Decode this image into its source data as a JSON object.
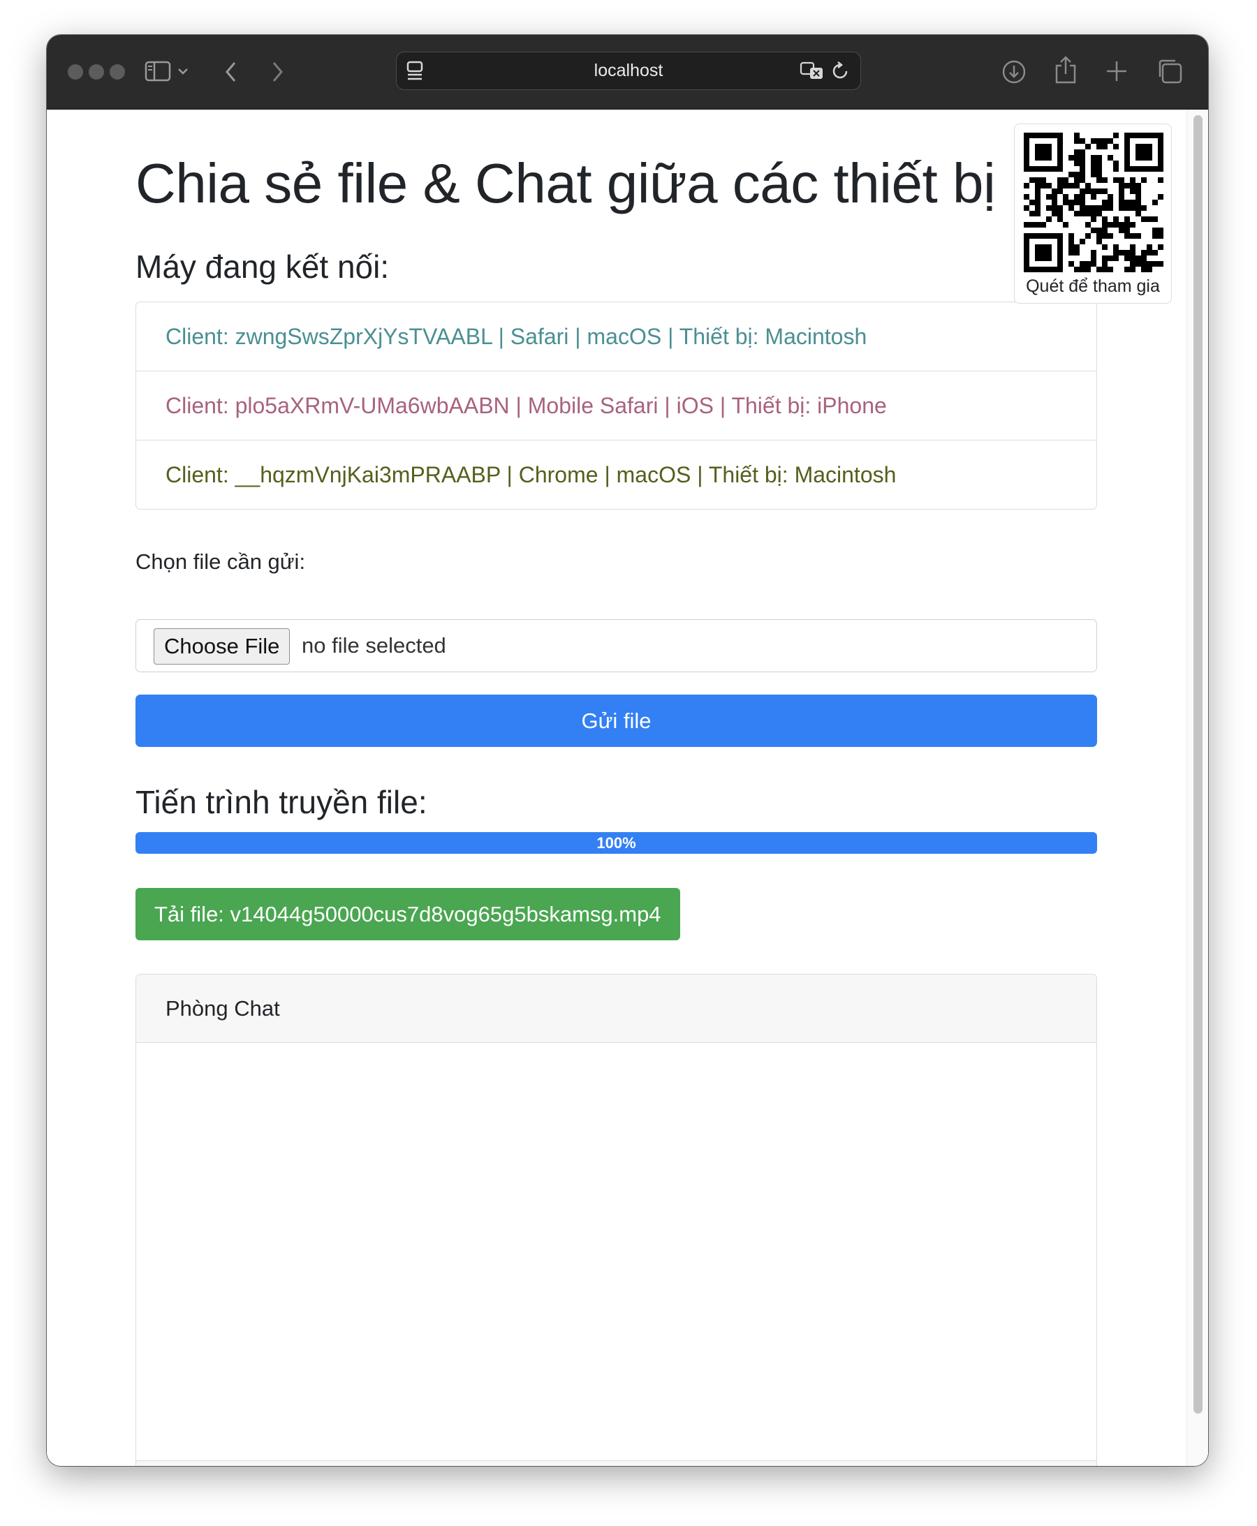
{
  "browser": {
    "url": "localhost"
  },
  "page": {
    "title": "Chia sẻ file & Chat giữa các thiết bị",
    "qr_caption": "Quét để tham gia",
    "clients_heading": "Máy đang kết nối:",
    "clients": [
      {
        "label": "Client: zwngSwsZprXjYsTVAABL | Safari | macOS | Thiết bị: Macintosh",
        "color": "#4a8f92"
      },
      {
        "label": "Client: plo5aXRmV-UMa6wbAABN | Mobile Safari | iOS | Thiết bị: iPhone",
        "color": "#a8627e"
      },
      {
        "label": "Client: __hqzmVnjKai3mPRAABP | Chrome | macOS | Thiết bị: Macintosh",
        "color": "#555f1c"
      }
    ],
    "file_label": "Chọn file cần gửi:",
    "choose_file": "Choose File",
    "file_status": "no file selected",
    "send_button": "Gửi file",
    "progress_heading": "Tiến trình truyền file:",
    "progress": {
      "value": 100,
      "label": "100%"
    },
    "download_link": "Tải file: v14044g50000cus7d8vog65g5bskamsg.mp4",
    "chat_title": "Phòng Chat"
  },
  "colors": {
    "primary": "#3280f4",
    "success": "#4aa651"
  }
}
